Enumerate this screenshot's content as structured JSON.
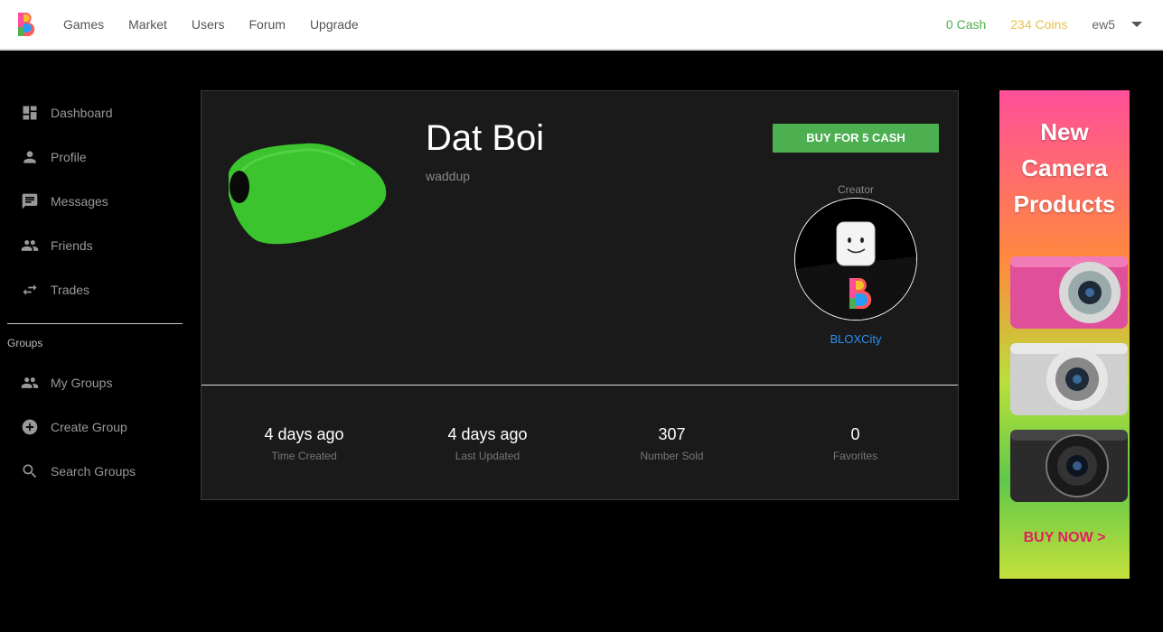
{
  "nav": {
    "links": [
      "Games",
      "Market",
      "Users",
      "Forum",
      "Upgrade"
    ],
    "cash": "0 Cash",
    "coins": "234 Coins",
    "username": "ew5"
  },
  "sidebar": {
    "items": [
      {
        "label": "Dashboard",
        "icon": "dashboard-icon"
      },
      {
        "label": "Profile",
        "icon": "person-icon"
      },
      {
        "label": "Messages",
        "icon": "message-icon"
      },
      {
        "label": "Friends",
        "icon": "people-icon"
      },
      {
        "label": "Trades",
        "icon": "swap-icon"
      }
    ],
    "groups_label": "Groups",
    "group_items": [
      {
        "label": "My Groups",
        "icon": "people-icon"
      },
      {
        "label": "Create Group",
        "icon": "add-circle-icon"
      },
      {
        "label": "Search Groups",
        "icon": "search-icon"
      }
    ]
  },
  "item": {
    "title": "Dat Boi",
    "description": "waddup",
    "buy_label": "BUY FOR 5 CASH",
    "creator_label": "Creator",
    "creator_name": "BLOXCity"
  },
  "stats": [
    {
      "value": "4 days ago",
      "label": "Time Created"
    },
    {
      "value": "4 days ago",
      "label": "Last Updated"
    },
    {
      "value": "307",
      "label": "Number Sold"
    },
    {
      "value": "0",
      "label": "Favorites"
    }
  ],
  "ad": {
    "title_lines": [
      "New",
      "Camera",
      "Products"
    ],
    "cta": "BUY NOW >"
  },
  "colors": {
    "accent_green": "#4caf50",
    "coins_gold": "#e8c14a",
    "link_blue": "#2b90f5",
    "card_bg": "#1a1a1a"
  }
}
